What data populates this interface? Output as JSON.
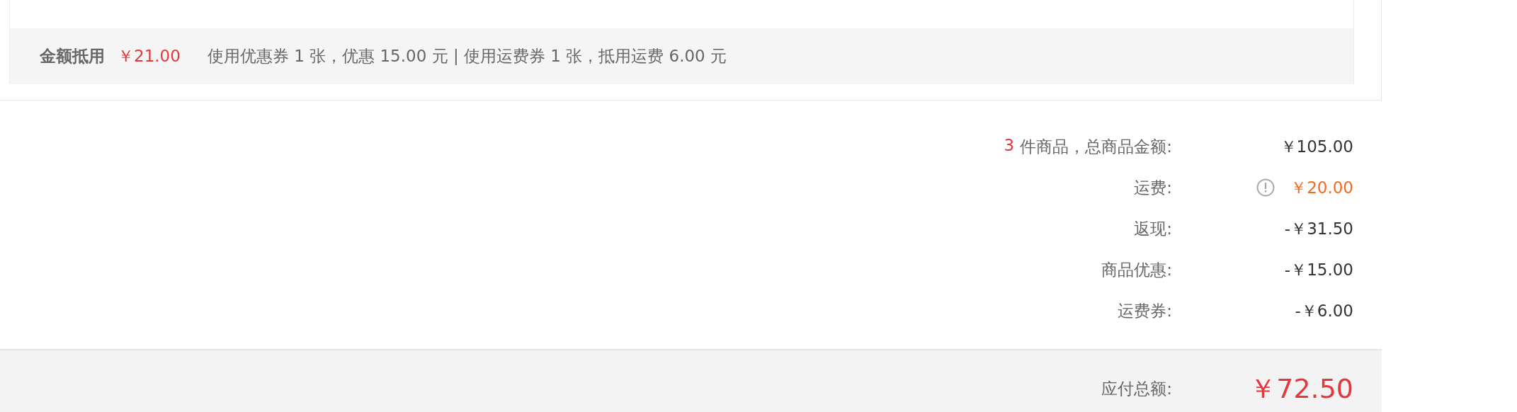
{
  "deduction": {
    "label": "金额抵用",
    "amount": "￥21.00",
    "details": "使用优惠券 1 张，优惠 15.00 元 | 使用运费券 1 张，抵用运费 6.00 元"
  },
  "summary": [
    {
      "count": "3",
      "label": "件商品，总商品金额:",
      "value": "￥105.00",
      "highlight": false,
      "info": false
    },
    {
      "label": "运费:",
      "value": "￥20.00",
      "highlight": true,
      "info": true
    },
    {
      "label": "返现:",
      "value": "-￥31.50",
      "highlight": false,
      "info": false
    },
    {
      "label": "商品优惠:",
      "value": "-￥15.00",
      "highlight": false,
      "info": false
    },
    {
      "label": "运费券:",
      "value": "-￥6.00",
      "highlight": false,
      "info": false
    }
  ],
  "total": {
    "label": "应付总额:",
    "value": "￥72.50"
  }
}
